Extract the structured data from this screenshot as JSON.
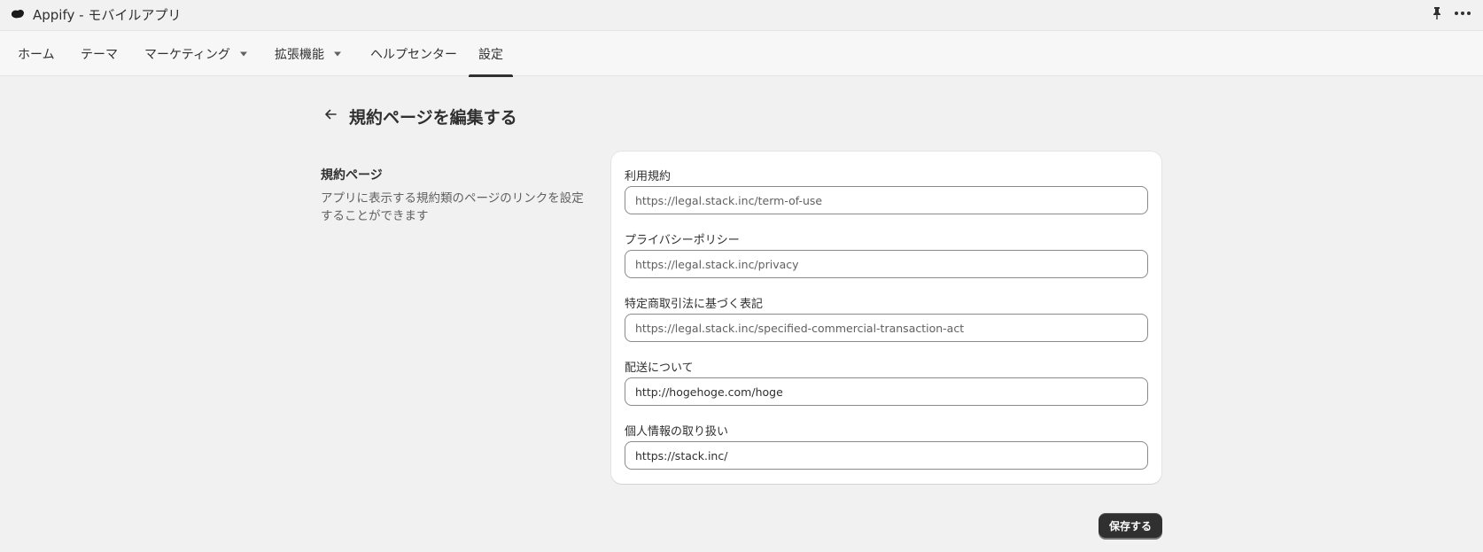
{
  "app": {
    "title": "Appify - モバイルアプリ",
    "logo_icon": "appify-logo-icon",
    "pin_icon": "pin-icon",
    "more_icon": "more-horizontal-icon"
  },
  "nav": {
    "items": [
      {
        "label": "ホーム",
        "has_dropdown": false,
        "active": false
      },
      {
        "label": "テーマ",
        "has_dropdown": false,
        "active": false
      },
      {
        "label": "マーケティング",
        "has_dropdown": true,
        "active": false
      },
      {
        "label": "拡張機能",
        "has_dropdown": true,
        "active": false
      },
      {
        "label": "ヘルプセンター",
        "has_dropdown": false,
        "active": false
      },
      {
        "label": "設定",
        "has_dropdown": false,
        "active": true
      }
    ]
  },
  "page": {
    "back_icon": "arrow-left-icon",
    "title": "規約ページを編集する"
  },
  "section": {
    "title": "規約ページ",
    "description": "アプリに表示する規約類のページのリンクを設定することができます"
  },
  "fields": [
    {
      "label": "利用規約",
      "value": "",
      "placeholder": "https://legal.stack.inc/term-of-use"
    },
    {
      "label": "プライバシーポリシー",
      "value": "",
      "placeholder": "https://legal.stack.inc/privacy"
    },
    {
      "label": "特定商取引法に基づく表記",
      "value": "",
      "placeholder": "https://legal.stack.inc/specified-commercial-transaction-act"
    },
    {
      "label": "配送について",
      "value": "http://hogehoge.com/hoge",
      "placeholder": ""
    },
    {
      "label": "個人情報の取り扱い",
      "value": "https://stack.inc/",
      "placeholder": ""
    }
  ],
  "actions": {
    "save_label": "保存する"
  },
  "colors": {
    "background": "#f1f1f1",
    "card": "#ffffff",
    "primary_button": "#303030",
    "text": "#303030",
    "muted_text": "#616161"
  }
}
